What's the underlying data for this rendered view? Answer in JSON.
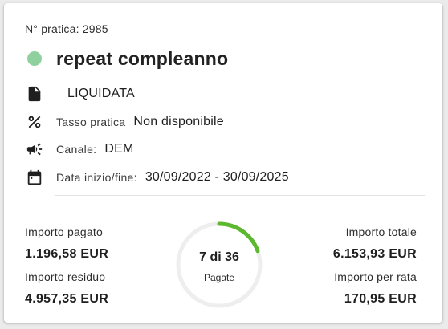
{
  "practice": {
    "number_label": "N° pratica: 2985",
    "title": "repeat compleanno",
    "status_color": "#8fd19e",
    "status": "LIQUIDATA",
    "rate_label": "Tasso pratica",
    "rate_value": "Non disponibile",
    "channel_label": "Canale:",
    "channel_value": "DEM",
    "dates_label": "Data inizio/fine:",
    "dates_value": "30/09/2022 - 30/09/2025"
  },
  "icons": {
    "status": "document-icon",
    "rate": "percent-icon",
    "channel": "megaphone-icon",
    "dates": "calendar-icon"
  },
  "amounts": {
    "paid_label": "Importo pagato",
    "paid_value": "1.196,58 EUR",
    "residual_label": "Importo residuo",
    "residual_value": "4.957,35 EUR",
    "total_label": "Importo totale",
    "total_value": "6.153,93 EUR",
    "installment_label": "Importo per rata",
    "installment_value": "170,95 EUR"
  },
  "progress": {
    "paid": 7,
    "total": 36,
    "main_text": "7 di 36",
    "sub_text": "Pagate",
    "color": "#5cb82e",
    "track_color": "#eeeeee"
  }
}
